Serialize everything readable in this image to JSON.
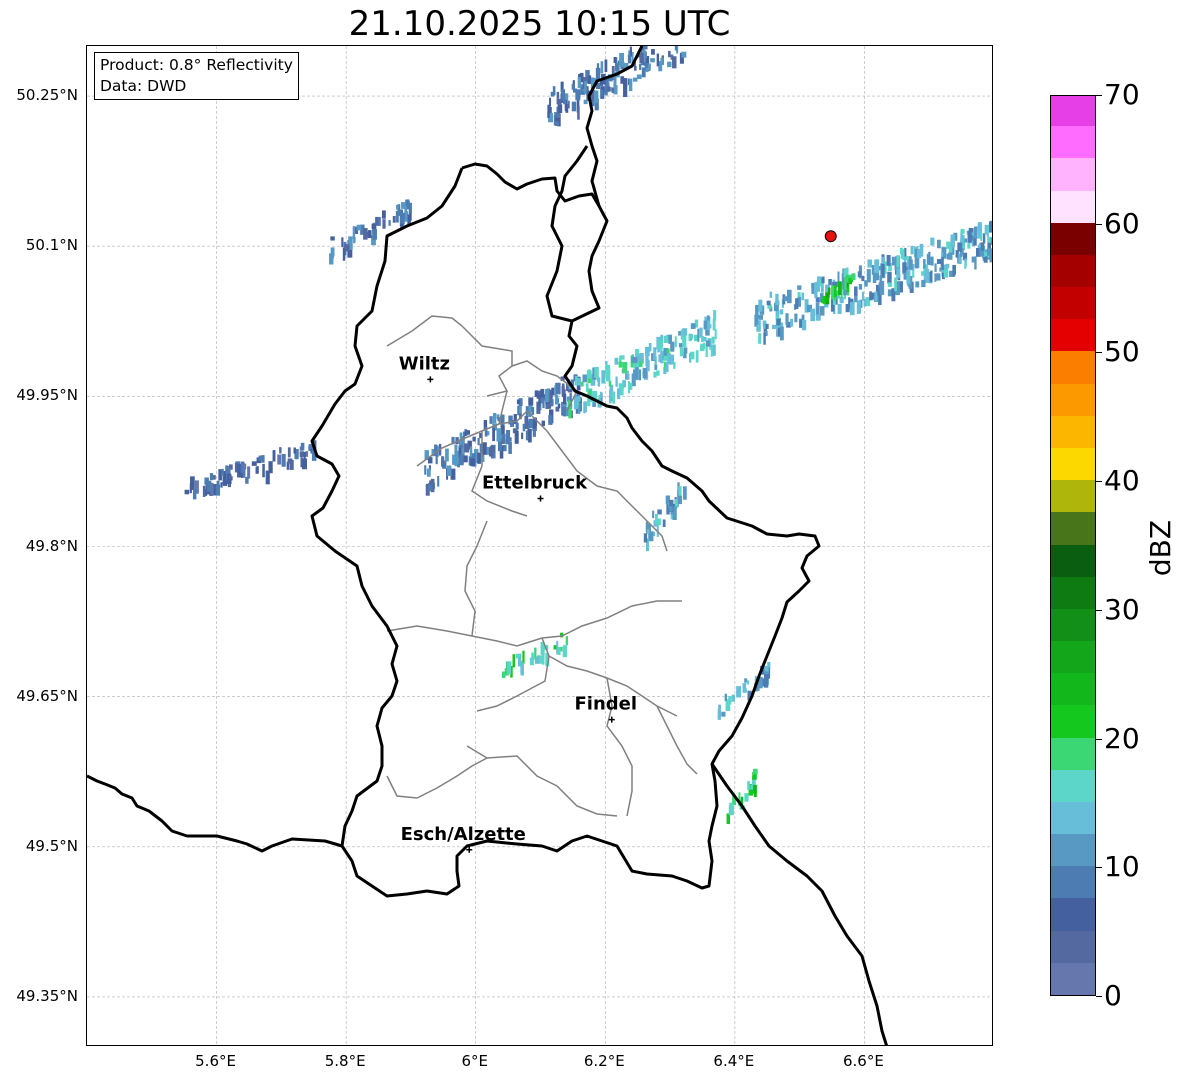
{
  "title": "21.10.2025 10:15 UTC",
  "info": {
    "product": "Product: 0.8° Reflectivity",
    "source": "Data: DWD"
  },
  "map": {
    "lon_range": [
      5.4,
      6.8
    ],
    "lat_range": [
      49.3,
      50.3
    ],
    "lat_ticks": [
      {
        "value": 50.25,
        "label": "50.25°N"
      },
      {
        "value": 50.1,
        "label": "50.1°N"
      },
      {
        "value": 49.95,
        "label": "49.95°N"
      },
      {
        "value": 49.8,
        "label": "49.8°N"
      },
      {
        "value": 49.65,
        "label": "49.65°N"
      },
      {
        "value": 49.5,
        "label": "49.5°N"
      },
      {
        "value": 49.35,
        "label": "49.35°N"
      }
    ],
    "lon_ticks": [
      {
        "value": 5.6,
        "label": "5.6°E"
      },
      {
        "value": 5.8,
        "label": "5.8°E"
      },
      {
        "value": 6.0,
        "label": "6°E"
      },
      {
        "value": 6.2,
        "label": "6.2°E"
      },
      {
        "value": 6.4,
        "label": "6.4°E"
      },
      {
        "value": 6.6,
        "label": "6.6°E"
      }
    ],
    "grid": true,
    "cities": [
      {
        "name": "Wiltz",
        "lon": 5.93,
        "lat": 49.967
      },
      {
        "name": "Ettelbruck",
        "lon": 6.1,
        "lat": 49.848
      },
      {
        "name": "Findel",
        "lon": 6.21,
        "lat": 49.627
      },
      {
        "name": "Esch/Alzette",
        "lon": 5.99,
        "lat": 49.497
      }
    ],
    "radar_site": {
      "lon": 6.548,
      "lat": 50.11,
      "color": "#e81010"
    },
    "colors": {
      "border": "#000000",
      "cantons": "#808080",
      "grid": "#b0b0b0"
    }
  },
  "colorbar": {
    "label": "dBZ",
    "min": 0,
    "max": 70,
    "step": 2.5,
    "tick_labels": [
      "0",
      "10",
      "20",
      "30",
      "40",
      "50",
      "60",
      "70"
    ],
    "colors": [
      "#6577ad",
      "#53699f",
      "#44609f",
      "#4d7cb3",
      "#5899c3",
      "#66bed9",
      "#5cd6c8",
      "#3cd775",
      "#14c81e",
      "#12b71b",
      "#13a51a",
      "#128f17",
      "#0e7a12",
      "#095e0f",
      "#48751a",
      "#aeb50b",
      "#fcd700",
      "#fcb600",
      "#fc9800",
      "#fc7e00",
      "#e40000",
      "#c20000",
      "#a40000",
      "#7a0000",
      "#ffe2ff",
      "#ffb3ff",
      "#ff6cff",
      "#e73fe7"
    ]
  },
  "chart_data": {
    "type": "heatmap",
    "title": "21.10.2025 10:15 UTC",
    "xlabel": "",
    "ylabel": "",
    "colorbar_label": "dBZ",
    "value_range": [
      0,
      70
    ],
    "xlim": [
      5.4,
      6.8
    ],
    "ylim": [
      49.3,
      50.3
    ],
    "echoes": [
      {
        "lon": [
          5.92,
          6.16
        ],
        "lat": [
          49.88,
          49.96
        ],
        "dbz": 8
      },
      {
        "lon": [
          6.14,
          6.37
        ],
        "lat": [
          49.95,
          50.02
        ],
        "dbz": 14
      },
      {
        "lon": [
          6.43,
          6.8
        ],
        "lat": [
          50.03,
          50.11
        ],
        "dbz": 12
      },
      {
        "lon": [
          6.53,
          6.58
        ],
        "lat": [
          50.05,
          50.07
        ],
        "dbz": 22
      },
      {
        "lon": [
          5.55,
          5.75
        ],
        "lat": [
          49.86,
          49.9
        ],
        "dbz": 6
      },
      {
        "lon": [
          5.77,
          5.9
        ],
        "lat": [
          50.1,
          50.14
        ],
        "dbz": 8
      },
      {
        "lon": [
          6.11,
          6.32
        ],
        "lat": [
          50.24,
          50.31
        ],
        "dbz": 8
      },
      {
        "lon": [
          6.25,
          6.32
        ],
        "lat": [
          49.81,
          49.86
        ],
        "dbz": 12
      },
      {
        "lon": [
          6.04,
          6.14
        ],
        "lat": [
          49.68,
          49.71
        ],
        "dbz": 18
      },
      {
        "lon": [
          6.38,
          6.43
        ],
        "lat": [
          49.53,
          49.57
        ],
        "dbz": 20
      },
      {
        "lon": [
          6.37,
          6.45
        ],
        "lat": [
          49.64,
          49.68
        ],
        "dbz": 12
      }
    ]
  }
}
